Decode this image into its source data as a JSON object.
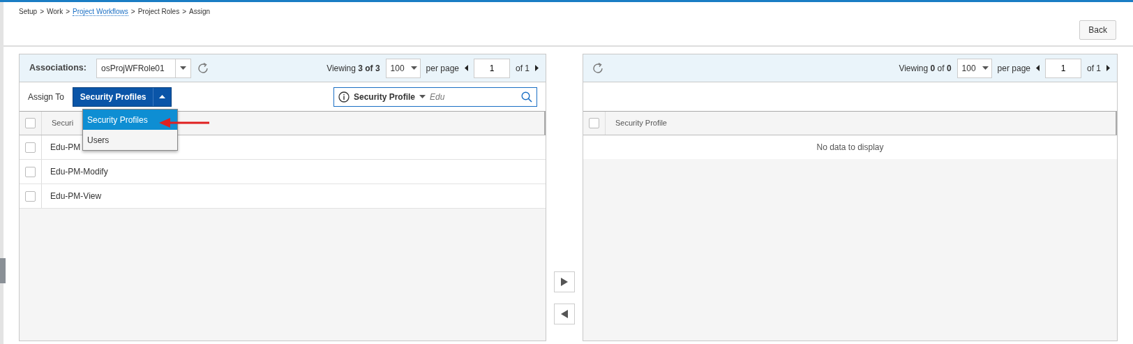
{
  "breadcrumb": [
    {
      "kind": "item",
      "label": "Setup"
    },
    {
      "kind": "separator",
      "label": ">"
    },
    {
      "kind": "item",
      "label": "Work"
    },
    {
      "kind": "separator",
      "label": ">"
    },
    {
      "kind": "link",
      "label": "Project Workflows"
    },
    {
      "kind": "separator",
      "label": ">"
    },
    {
      "kind": "item",
      "label": "Project Roles"
    },
    {
      "kind": "separator",
      "label": ">"
    },
    {
      "kind": "item",
      "label": "Assign"
    }
  ],
  "back_button": "Back",
  "left_panel": {
    "associations_label": "Associations:",
    "association_value": "osProjWFRole01",
    "viewing": "Viewing **3 of 3**",
    "per_page_value": "100",
    "per_page_label": "per page",
    "page": "1",
    "page_total": "of 1",
    "assign_to_label": "Assign To",
    "assign_to_value": "Security Profiles",
    "assign_to_options": [
      {
        "label": "Security Profiles",
        "selected": true
      },
      {
        "label": "Users",
        "selected": false
      }
    ],
    "search": {
      "field": "Security Profile",
      "value": "Edu"
    },
    "header_checked": false,
    "column": "Securi",
    "rows": [
      {
        "label": "Edu-PM",
        "checked": false
      },
      {
        "label": "Edu-PM-Modify",
        "checked": false
      },
      {
        "label": "Edu-PM-View",
        "checked": false
      }
    ]
  },
  "right_panel": {
    "viewing": "Viewing **0** of **0**",
    "per_page_value": "100",
    "per_page_label": "per page",
    "page": "1",
    "page_total": "of 1",
    "header_checked": false,
    "column": "Security Profile",
    "empty_message": "No data to display"
  }
}
